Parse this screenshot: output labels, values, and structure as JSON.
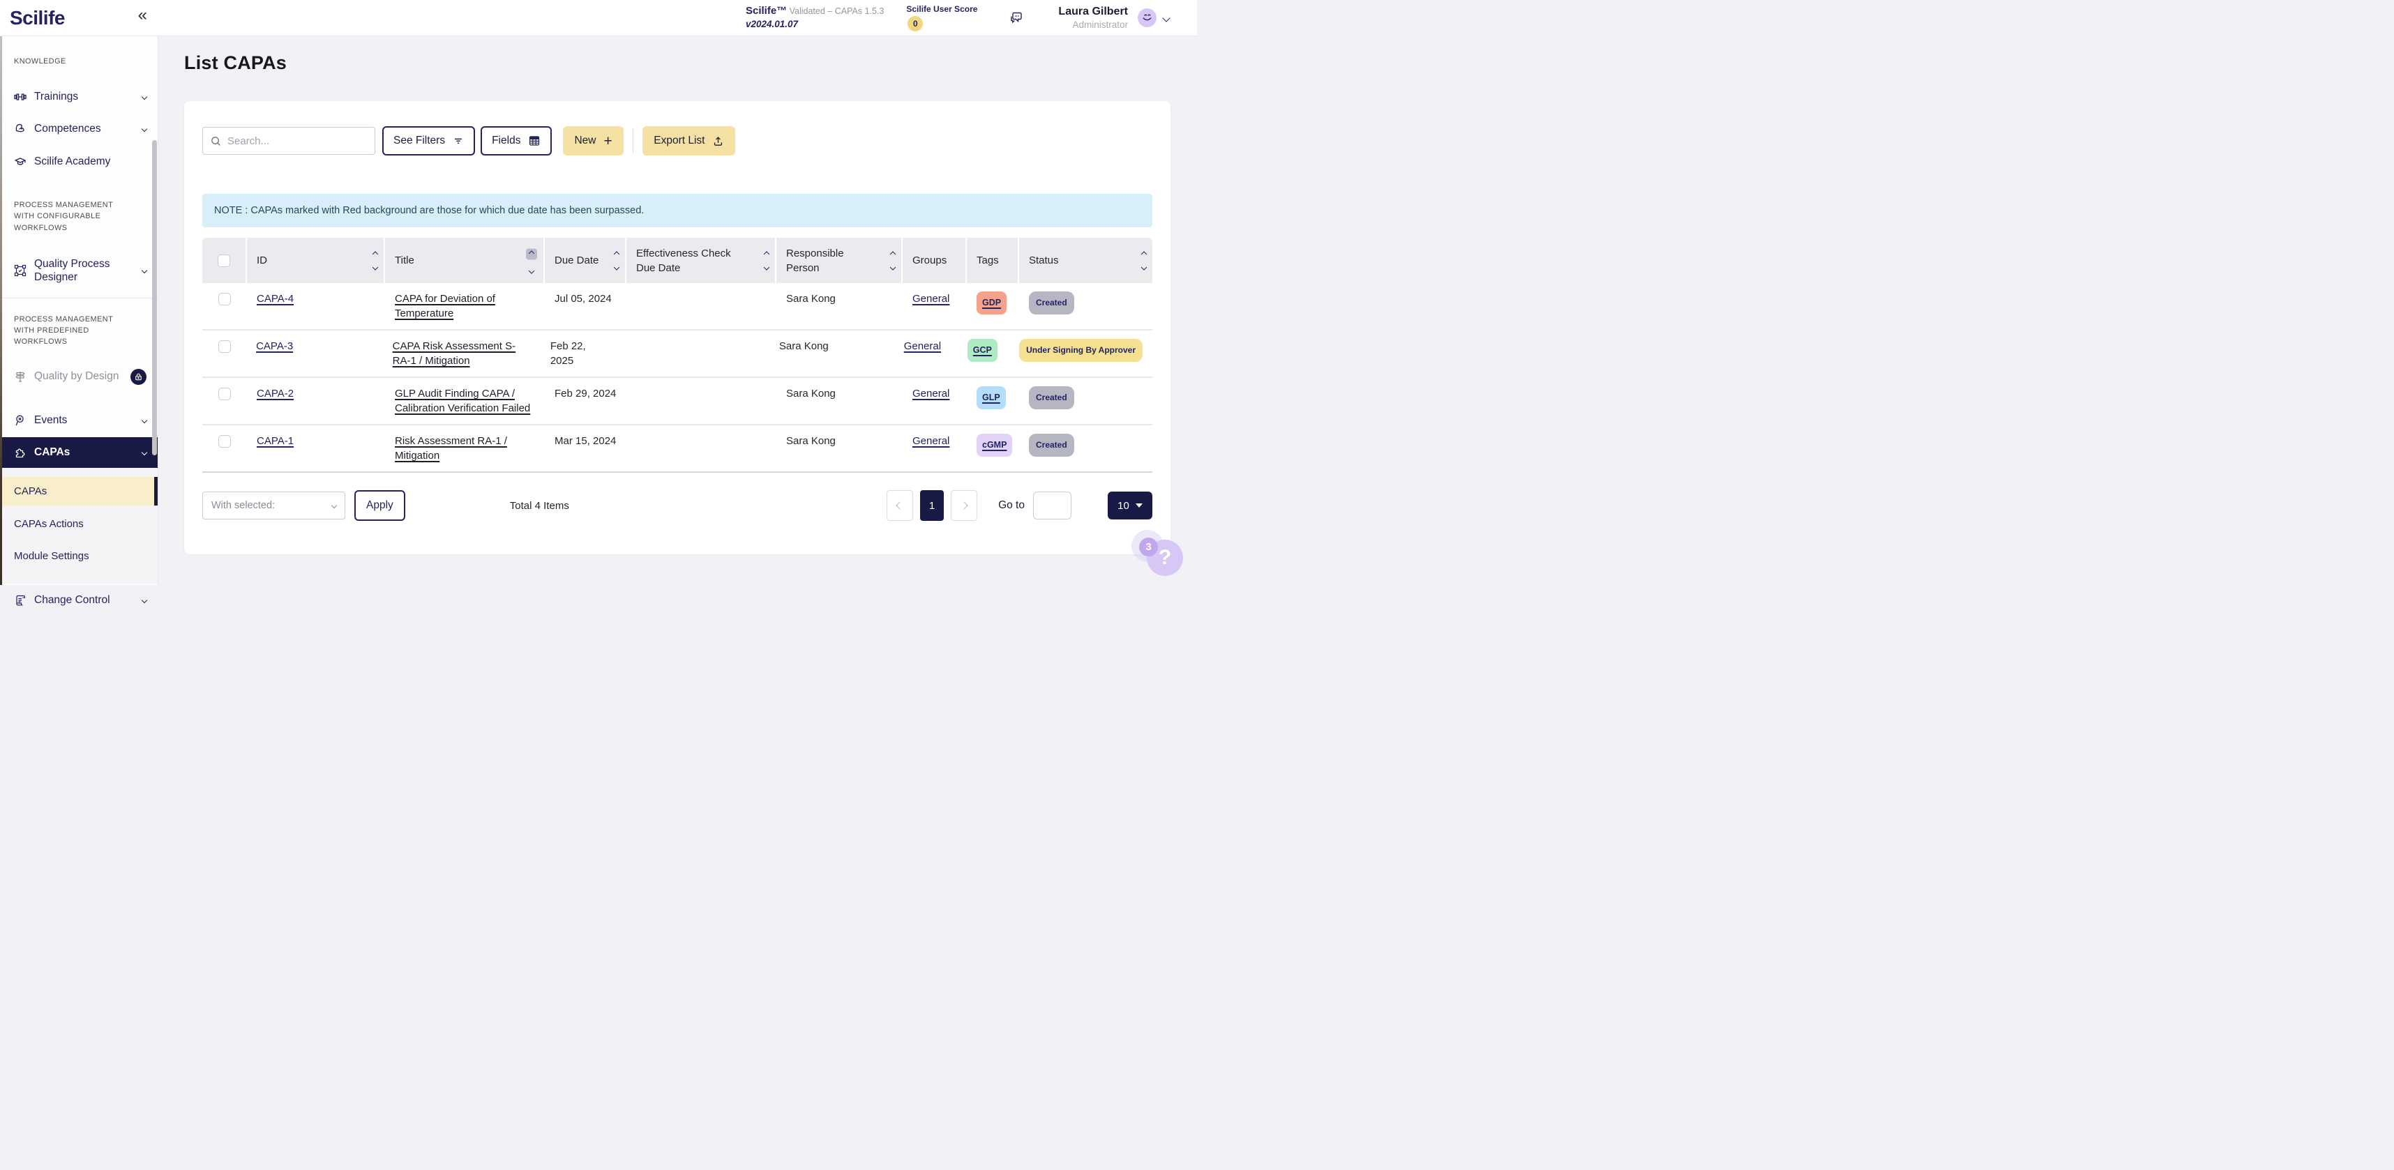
{
  "brand": {
    "logo_text": "Scilife"
  },
  "topbar": {
    "product": "Scilife™",
    "validated_text": " Validated – CAPAs 1.5.3",
    "version": "v2024.01.07",
    "user_score_label": "Scilife User Score",
    "user_score_value": "0",
    "user_name": "Laura Gilbert",
    "user_role": "Administrator"
  },
  "sidebar": {
    "sections": {
      "knowledge": "KNOWLEDGE",
      "configurable": "PROCESS MANAGEMENT WITH CONFIGURABLE WORKFLOWS",
      "predefined": "PROCESS MANAGEMENT WITH PREDEFINED WORKFLOWS"
    },
    "trainings": "Trainings",
    "competences": "Competences",
    "academy": "Scilife Academy",
    "qpd": "Quality Process Designer",
    "qbd": "Quality by Design",
    "events": "Events",
    "capas": "CAPAs",
    "submenu": [
      "CAPAs",
      "CAPAs Actions",
      "Module Settings"
    ],
    "change_control": "Change Control"
  },
  "page": {
    "title": "List CAPAs"
  },
  "toolbar": {
    "search_placeholder": "Search...",
    "see_filters": "See Filters",
    "fields": "Fields",
    "new": "New",
    "export": "Export List"
  },
  "note": "NOTE : CAPAs marked with Red background are those for which due date has been surpassed.",
  "table": {
    "columns": {
      "id": "ID",
      "title": "Title",
      "due": "Due Date",
      "eff": "Effectiveness Check Due Date",
      "resp": "Responsible Person",
      "groups": "Groups",
      "tags": "Tags",
      "status": "Status"
    },
    "rows": [
      {
        "id": "CAPA-4",
        "title": "CAPA for Deviation of Temperature",
        "due": "Jul 05, 2024",
        "eff": "",
        "person": "Sara Kong",
        "group": "General",
        "tag": "GDP",
        "tag_bg": "#f4a28c",
        "status": "Created",
        "status_bg": "#b6b6c3"
      },
      {
        "id": "CAPA-3",
        "title": "CAPA Risk Assessment S-RA-1 / Mitigation",
        "due": "Feb 22, 2025",
        "eff": "",
        "person": "Sara Kong",
        "group": "General",
        "tag": "GCP",
        "tag_bg": "#aeeac4",
        "status": "Under Signing By Approver",
        "status_bg": "#f6e193"
      },
      {
        "id": "CAPA-2",
        "title": "GLP Audit Finding CAPA / Calibration Verification Failed",
        "due": "Feb 29, 2024",
        "eff": "",
        "person": "Sara Kong",
        "group": "General",
        "tag": "GLP",
        "tag_bg": "#b3ddf8",
        "status": "Created",
        "status_bg": "#b6b6c3"
      },
      {
        "id": "CAPA-1",
        "title": "Risk Assessment RA-1 / Mitigation",
        "due": "Mar 15, 2024",
        "eff": "",
        "person": "Sara Kong",
        "group": "General",
        "tag": "cGMP",
        "tag_bg": "#e2d2f8",
        "status": "Created",
        "status_bg": "#b6b6c3"
      }
    ]
  },
  "footer": {
    "with_selected": "With selected:",
    "apply": "Apply",
    "total": "Total 4 Items",
    "current_page": "1",
    "go_to": "Go to",
    "page_size": "10"
  },
  "help": {
    "badge": "3",
    "question": "?"
  },
  "colors": {
    "accent_navy": "#191945",
    "accent_yellow": "#f5e1a4",
    "note_bg": "#d8eef9"
  }
}
